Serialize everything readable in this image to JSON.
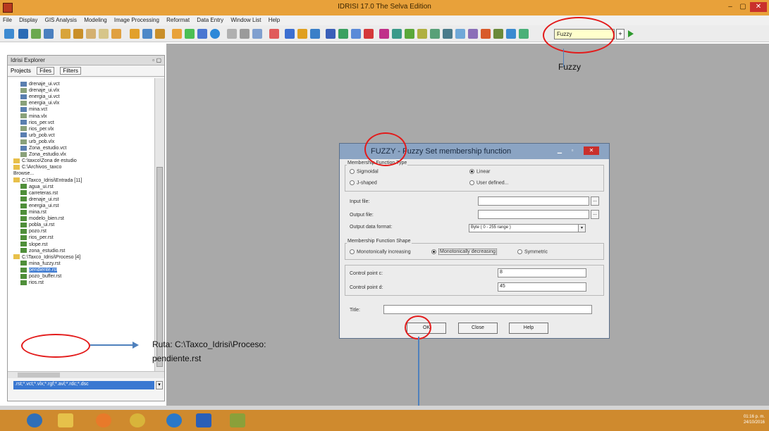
{
  "window": {
    "title": "IDRISI 17.0  The Selva Edition",
    "minimize": "–",
    "maximize": "▢",
    "close": "✕"
  },
  "menu": [
    "File",
    "Display",
    "GIS Analysis",
    "Modeling",
    "Image Processing",
    "Reformat",
    "Data Entry",
    "Window List",
    "Help"
  ],
  "toolbar": {
    "module_search_value": "Fuzzy",
    "add_label": "+"
  },
  "explorer": {
    "title": "Idrisi Explorer",
    "pin": "▫",
    "close": "▢",
    "tabs": [
      "Projects",
      "Files",
      "Filters"
    ],
    "files_top": [
      "drenaje_ui.vct",
      "drenaje_ui.vlx",
      "energia_ui.vct",
      "energia_ui.vlx",
      "mina.vct",
      "mina.vlx",
      "rios_per.vct",
      "rios_per.vlx",
      "urb_pob.vct",
      "urb_pob.vlx",
      "Zona_estudio.vct",
      "Zona_estudio.vlx"
    ],
    "folders_mid": [
      "C:\\taxco\\Zona de estudio",
      "C:\\Archivos_taxco",
      "Browse..."
    ],
    "folder_entrada": "C:\\Taxco_Idrisi\\Entrada [11]",
    "files_entrada": [
      "agua_ui.rst",
      "carreteras.rst",
      "drenaje_ui.rst",
      "energia_ui.rst",
      "mina.rst",
      "modelo_bien.rst",
      "pobla_ui.rst",
      "pozo.rst",
      "rios_per.rst",
      "slope.rst",
      "zona_estudio.rst"
    ],
    "folder_proceso": "C:\\Taxco_Idrisi\\Proceso [4]",
    "files_proceso": [
      "mina_fuzzy.rst",
      "pendiente.rst",
      "pozo_buffer.rst",
      "rios.rst"
    ],
    "filter_value": ".rst;*.vct;*.vlx;*.rgf;*.avl;*.rdc;*.dsc"
  },
  "dialog": {
    "title": "FUZZY - Fuzzy Set membership function",
    "membership_type_label": "Membership Function Type",
    "type_options": [
      "Sigmoidal",
      "J-shaped",
      "Linear",
      "User defined..."
    ],
    "type_selected": "Linear",
    "input_file_label": "Input file:",
    "input_file_value": "",
    "output_file_label": "Output file:",
    "output_file_value": "",
    "output_format_label": "Output data format:",
    "output_format_value": "Byte ( 0 - 255 range )",
    "shape_label": "Membership Function Shape",
    "shape_options": [
      "Monotonically increasing",
      "Monotonically decreasing",
      "Symmetric"
    ],
    "shape_selected": "Monotonically decreasing",
    "control_c_label": "Control point c:",
    "control_c_value": "8",
    "control_d_label": "Control point d:",
    "control_d_value": "45",
    "title_label": "Title:",
    "title_value": "",
    "ok_label": "OK",
    "close_label": "Close",
    "help_label": "Help",
    "browse_label": "..."
  },
  "annotations": {
    "fuzzy_caption": "Fuzzy",
    "ruta_line1": "Ruta: C:\\Taxco_Idrisi\\Proceso:",
    "ruta_line2": "pendiente.rst",
    "ring_color": "#e31b1b",
    "arrow_color": "#4f81bd"
  },
  "taskbar": {
    "time": "01:16 p. m.",
    "date": "24/10/2016"
  },
  "colors": {
    "titlebar": "#e8a13a",
    "workspace": "#a9a9a9",
    "taskbar": "#cf8a2e"
  }
}
